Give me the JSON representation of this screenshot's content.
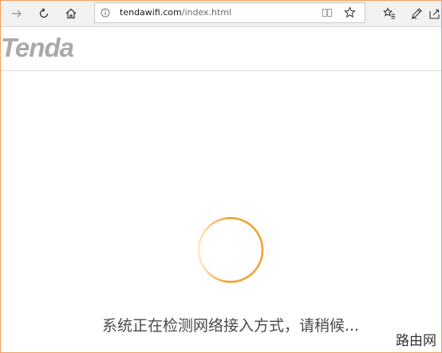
{
  "browser": {
    "address": {
      "host": "tendawifi.com",
      "path": "/index.html"
    },
    "icons": [
      "forward-icon",
      "refresh-icon",
      "home-icon",
      "info-icon",
      "reading-view-icon",
      "favorite-star-icon",
      "favorites-list-icon",
      "pen-notes-icon",
      "share-icon"
    ]
  },
  "header": {
    "logo_text": "Tenda"
  },
  "main": {
    "status_text": "系统正在检测网络接入方式，请稍候..."
  },
  "watermark": {
    "text": "路由网"
  },
  "colors": {
    "spinner": "#f0a030",
    "logo": "#a9a9a9",
    "border": "#f0a060"
  }
}
